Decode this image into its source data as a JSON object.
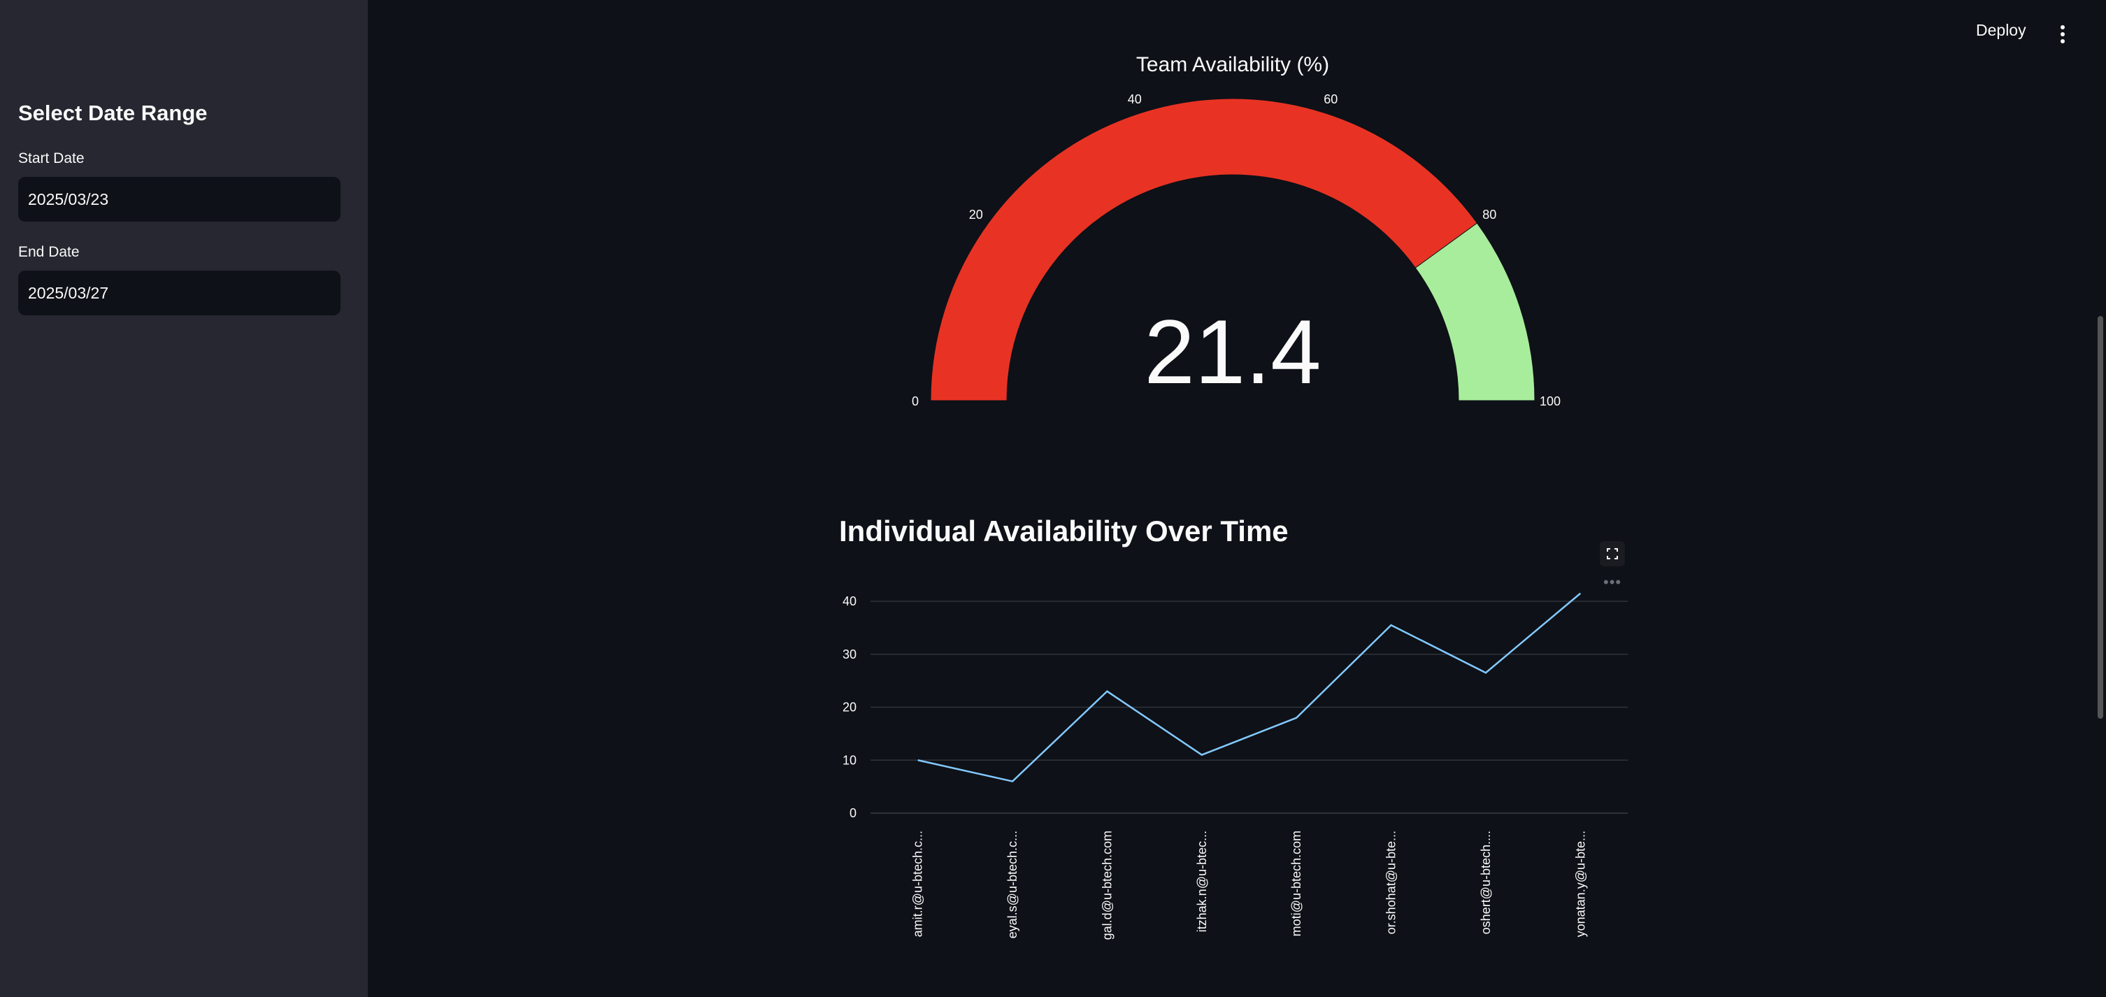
{
  "header": {
    "deploy_label": "Deploy",
    "menu_icon": "vertical-dots-icon"
  },
  "sidebar": {
    "title": "Select Date Range",
    "start_label": "Start Date",
    "start_value": "2025/03/23",
    "end_label": "End Date",
    "end_value": "2025/03/27"
  },
  "colors": {
    "low": "#e83324",
    "high": "#a8ed9b",
    "line": "#83c9ff",
    "background": "#0e1117",
    "sidebar": "#262730"
  },
  "chart_data": [
    {
      "type": "gauge",
      "title": "Team Availability (%)",
      "value": 21.4,
      "value_text": "21.4",
      "range": [
        0,
        100
      ],
      "ticks": [
        "0",
        "20",
        "40",
        "60",
        "80",
        "100"
      ],
      "bands": [
        {
          "from": 0,
          "to": 80,
          "color": "#e83324"
        },
        {
          "from": 80,
          "to": 100,
          "color": "#a8ed9b"
        }
      ]
    },
    {
      "type": "line",
      "title": "Individual Availability Over Time",
      "categories": [
        "amit.r@u-btech.c...",
        "eyal.s@u-btech.c...",
        "gal.d@u-btech.com",
        "itzhak.n@u-btec...",
        "moti@u-btech.com",
        "or.shohat@u-bte...",
        "oshert@u-btech....",
        "yonatan.y@u-bte..."
      ],
      "values": [
        10,
        6,
        23,
        11,
        18,
        35.5,
        26.5,
        41.5
      ],
      "yticks": [
        "0",
        "10",
        "20",
        "30",
        "40"
      ],
      "ylim": [
        0,
        40
      ],
      "grid": true
    }
  ]
}
